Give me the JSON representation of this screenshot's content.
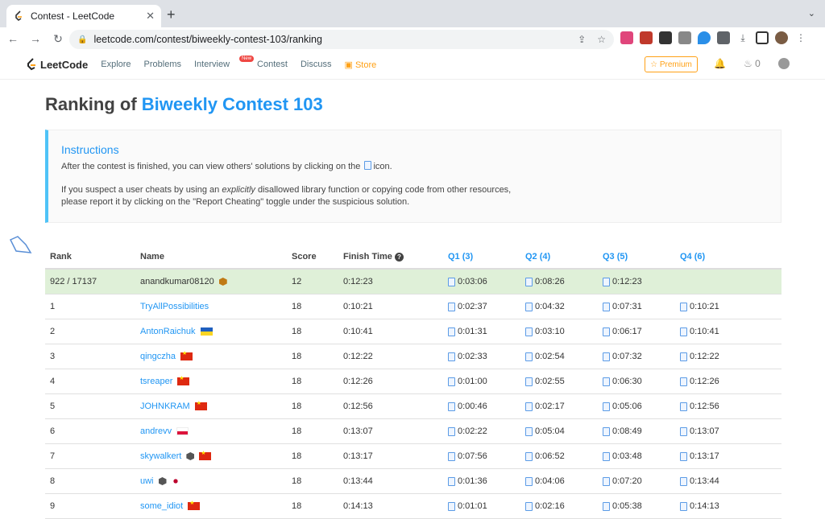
{
  "browser": {
    "tab_title": "Contest - LeetCode",
    "url": "leetcode.com/contest/biweekly-contest-103/ranking"
  },
  "nav": {
    "logo": "LeetCode",
    "links": [
      "Explore",
      "Problems",
      "Interview",
      "Contest",
      "Discuss",
      "Store"
    ],
    "new_badge": "New",
    "premium": "Premium",
    "coins": "0"
  },
  "page": {
    "title_prefix": "Ranking of ",
    "title_contest": "Biweekly Contest 103"
  },
  "instructions": {
    "heading": "Instructions",
    "p1_before": "After the contest is finished, you can view others' solutions by clicking on the",
    "p1_after": "icon.",
    "p2_before": "If you suspect a user cheats by using an ",
    "p2_em": "explicitly",
    "p2_after": " disallowed library function or copying code from other resources,",
    "p2_line2": "please report it by clicking on the \"Report Cheating\" toggle under the suspicious solution."
  },
  "table": {
    "headers": {
      "rank": "Rank",
      "name": "Name",
      "score": "Score",
      "finish": "Finish Time",
      "q1": "Q1 (3)",
      "q2": "Q2 (4)",
      "q3": "Q3 (5)",
      "q4": "Q4 (6)"
    },
    "rows": [
      {
        "rank": "922 / 17137",
        "name": "anandkumar08120",
        "score": "12",
        "finish": "0:12:23",
        "q1": "0:03:06",
        "q2": "0:08:26",
        "q3": "0:12:23",
        "q4": ""
      },
      {
        "rank": "1",
        "name": "TryAllPossibilities",
        "score": "18",
        "finish": "0:10:21",
        "q1": "0:02:37",
        "q2": "0:04:32",
        "q3": "0:07:31",
        "q4": "0:10:21"
      },
      {
        "rank": "2",
        "name": "AntonRaichuk",
        "score": "18",
        "finish": "0:10:41",
        "q1": "0:01:31",
        "q2": "0:03:10",
        "q3": "0:06:17",
        "q4": "0:10:41"
      },
      {
        "rank": "3",
        "name": "qingczha",
        "score": "18",
        "finish": "0:12:22",
        "q1": "0:02:33",
        "q2": "0:02:54",
        "q3": "0:07:32",
        "q4": "0:12:22"
      },
      {
        "rank": "4",
        "name": "tsreaper",
        "score": "18",
        "finish": "0:12:26",
        "q1": "0:01:00",
        "q2": "0:02:55",
        "q3": "0:06:30",
        "q4": "0:12:26"
      },
      {
        "rank": "5",
        "name": "JOHNKRAM",
        "score": "18",
        "finish": "0:12:56",
        "q1": "0:00:46",
        "q2": "0:02:17",
        "q3": "0:05:06",
        "q4": "0:12:56"
      },
      {
        "rank": "6",
        "name": "andrevv",
        "score": "18",
        "finish": "0:13:07",
        "q1": "0:02:22",
        "q2": "0:05:04",
        "q3": "0:08:49",
        "q4": "0:13:07"
      },
      {
        "rank": "7",
        "name": "skywalkert",
        "score": "18",
        "finish": "0:13:17",
        "q1": "0:07:56",
        "q2": "0:06:52",
        "q3": "0:03:48",
        "q4": "0:13:17"
      },
      {
        "rank": "8",
        "name": "uwi",
        "score": "18",
        "finish": "0:13:44",
        "q1": "0:01:36",
        "q2": "0:04:06",
        "q3": "0:07:20",
        "q4": "0:13:44"
      },
      {
        "rank": "9",
        "name": "some_idiot",
        "score": "18",
        "finish": "0:14:13",
        "q1": "0:01:01",
        "q2": "0:02:16",
        "q3": "0:05:38",
        "q4": "0:14:13"
      }
    ]
  }
}
